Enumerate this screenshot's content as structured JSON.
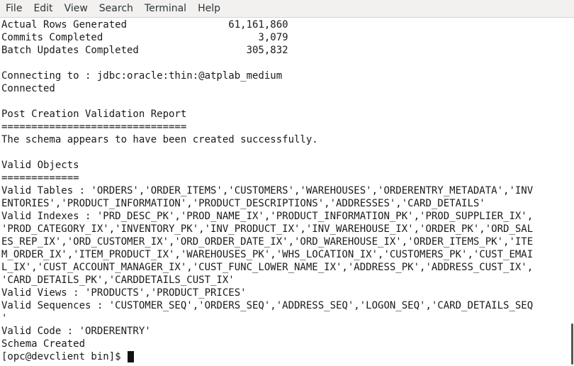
{
  "menu": {
    "items": [
      "File",
      "Edit",
      "View",
      "Search",
      "Terminal",
      "Help"
    ]
  },
  "terminal": {
    "lines": [
      "Actual Rows Generated                 61,161,860",
      "Commits Completed                          3,079",
      "Batch Updates Completed                  305,832",
      "",
      "Connecting to : jdbc:oracle:thin:@atplab_medium",
      "Connected",
      "",
      "Post Creation Validation Report",
      "===============================",
      "The schema appears to have been created successfully.",
      "",
      "Valid Objects",
      "=============",
      "Valid Tables : 'ORDERS','ORDER_ITEMS','CUSTOMERS','WAREHOUSES','ORDERENTRY_METADATA','INV",
      "ENTORIES','PRODUCT_INFORMATION','PRODUCT_DESCRIPTIONS','ADDRESSES','CARD_DETAILS'",
      "Valid Indexes : 'PRD_DESC_PK','PROD_NAME_IX','PRODUCT_INFORMATION_PK','PROD_SUPPLIER_IX',",
      "'PROD_CATEGORY_IX','INVENTORY_PK','INV_PRODUCT_IX','INV_WAREHOUSE_IX','ORDER_PK','ORD_SAL",
      "ES_REP_IX','ORD_CUSTOMER_IX','ORD_ORDER_DATE_IX','ORD_WAREHOUSE_IX','ORDER_ITEMS_PK','ITE",
      "M_ORDER_IX','ITEM_PRODUCT_IX','WAREHOUSES_PK','WHS_LOCATION_IX','CUSTOMERS_PK','CUST_EMAI",
      "L_IX','CUST_ACCOUNT_MANAGER_IX','CUST_FUNC_LOWER_NAME_IX','ADDRESS_PK','ADDRESS_CUST_IX',",
      "'CARD_DETAILS_PK','CARDDETAILS_CUST_IX'",
      "Valid Views : 'PRODUCTS','PRODUCT_PRICES'",
      "Valid Sequences : 'CUSTOMER_SEQ','ORDERS_SEQ','ADDRESS_SEQ','LOGON_SEQ','CARD_DETAILS_SEQ",
      "'",
      "Valid Code : 'ORDERENTRY'",
      "Schema Created"
    ],
    "prompt": "[opc@devclient bin]$ "
  }
}
